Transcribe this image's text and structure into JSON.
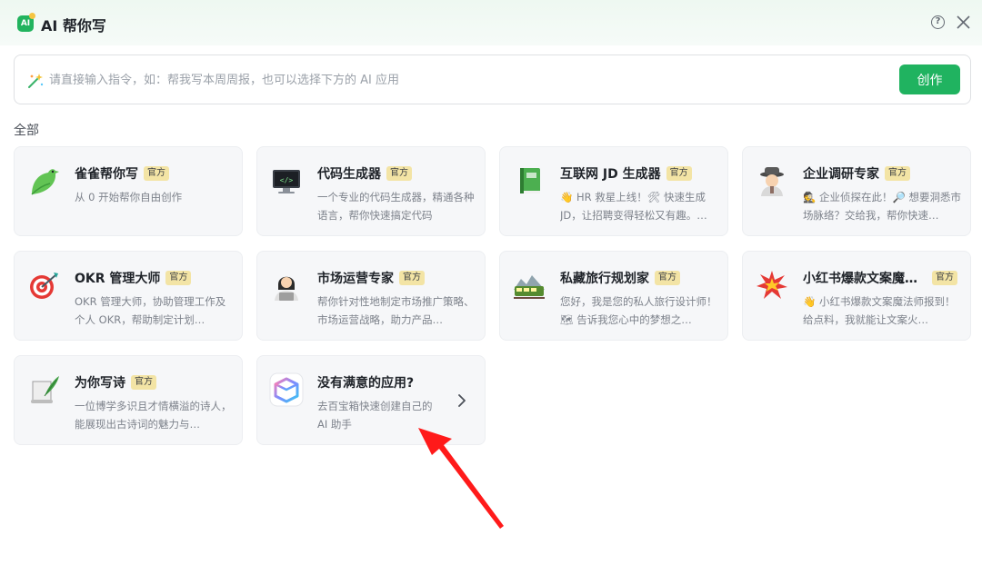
{
  "header": {
    "logo_text": "AI",
    "title": "AI 帮你写"
  },
  "prompt": {
    "placeholder": "请直接输入指令，如：帮我写本周周报，也可以选择下方的 AI 应用",
    "value": "",
    "button_label": "创作"
  },
  "section": {
    "label": "全部"
  },
  "apps": [
    {
      "icon": "bird-icon",
      "title": "雀雀帮你写",
      "badge": "官方",
      "desc": "从 0 开始帮你自由创作"
    },
    {
      "icon": "code-monitor-icon",
      "title": "代码生成器",
      "badge": "官方",
      "desc": "一个专业的代码生成器，精通各种语言，帮你快速搞定代码"
    },
    {
      "icon": "green-book-icon",
      "title": "互联网 JD 生成器",
      "badge": "官方",
      "desc": "👋 HR 救星上线！🛠 快速生成 JD，让招聘变得轻松又有趣。…"
    },
    {
      "icon": "detective-icon",
      "title": "企业调研专家",
      "badge": "官方",
      "desc": "🕵 企业侦探在此！🔎 想要洞悉市场脉络？交给我，帮你快速…"
    },
    {
      "icon": "target-icon",
      "title": "OKR 管理大师",
      "badge": "官方",
      "desc": "OKR 管理大师，协助管理工作及个人 OKR，帮助制定计划…"
    },
    {
      "icon": "laptop-person-icon",
      "title": "市场运营专家",
      "badge": "官方",
      "desc": "帮你针对性地制定市场推广策略、市场运营战略，助力产品…"
    },
    {
      "icon": "train-icon",
      "title": "私藏旅行规划家",
      "badge": "官方",
      "desc": "您好，我是您的私人旅行设计师！🗺 告诉我您心中的梦想之…"
    },
    {
      "icon": "explosion-icon",
      "title": "小红书爆款文案魔…",
      "badge": "官方",
      "desc": "👋 小红书爆款文案魔法师报到！给点料，我就能让文案火…"
    },
    {
      "icon": "scroll-quill-icon",
      "title": "为你写诗",
      "badge": "官方",
      "desc": "一位博学多识且才情横溢的诗人，能展现出古诗词的魅力与…"
    },
    {
      "icon": "box-app-icon",
      "title": "没有满意的应用?",
      "badge": "",
      "desc": "去百宝箱快速创建自己的 AI 助手"
    }
  ],
  "colors": {
    "accent": "#20b360",
    "badge_bg": "#f3e4a5",
    "card_bg": "#f6f7f9",
    "annotation_arrow": "#ff1a1a"
  }
}
